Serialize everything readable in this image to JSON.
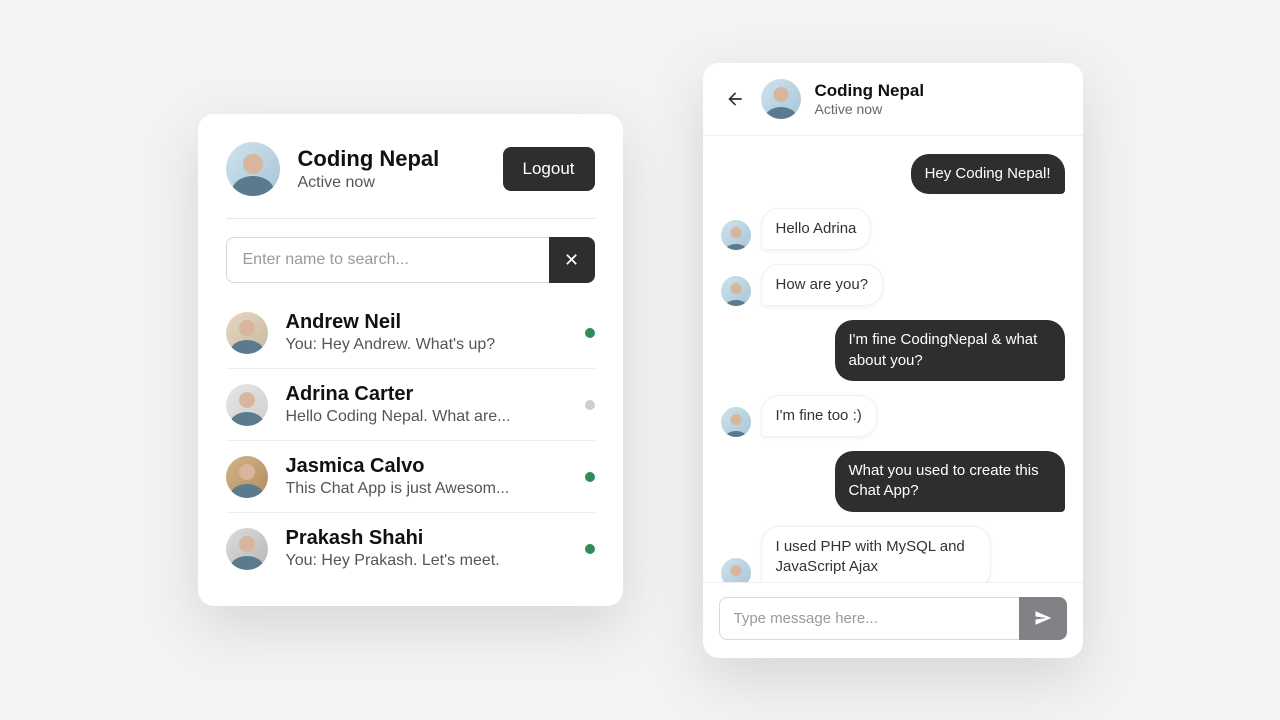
{
  "left": {
    "me": {
      "name": "Coding Nepal",
      "status": "Active now"
    },
    "logout": "Logout",
    "search_placeholder": "Enter name to search...",
    "contacts": [
      {
        "name": "Andrew Neil",
        "preview": "You: Hey Andrew. What's up?",
        "online": true
      },
      {
        "name": "Adrina Carter",
        "preview": "Hello Coding Nepal. What are...",
        "online": false
      },
      {
        "name": "Jasmica Calvo",
        "preview": "This Chat App is just Awesom...",
        "online": true
      },
      {
        "name": "Prakash Shahi",
        "preview": "You: Hey Prakash. Let's meet.",
        "online": true
      }
    ]
  },
  "chat": {
    "header": {
      "name": "Coding Nepal",
      "status": "Active now"
    },
    "messages": [
      {
        "side": "out",
        "text": "Hey Coding Nepal!"
      },
      {
        "side": "in",
        "text": "Hello Adrina"
      },
      {
        "side": "in",
        "text": "How are you?"
      },
      {
        "side": "out",
        "text": "I'm fine CodingNepal & what about you?"
      },
      {
        "side": "in",
        "text": "I'm fine too :)"
      },
      {
        "side": "out",
        "text": "What you used to create this Chat App?"
      },
      {
        "side": "in",
        "text": "I used PHP with MySQL and JavaScript Ajax"
      }
    ],
    "compose_placeholder": "Type message here..."
  }
}
